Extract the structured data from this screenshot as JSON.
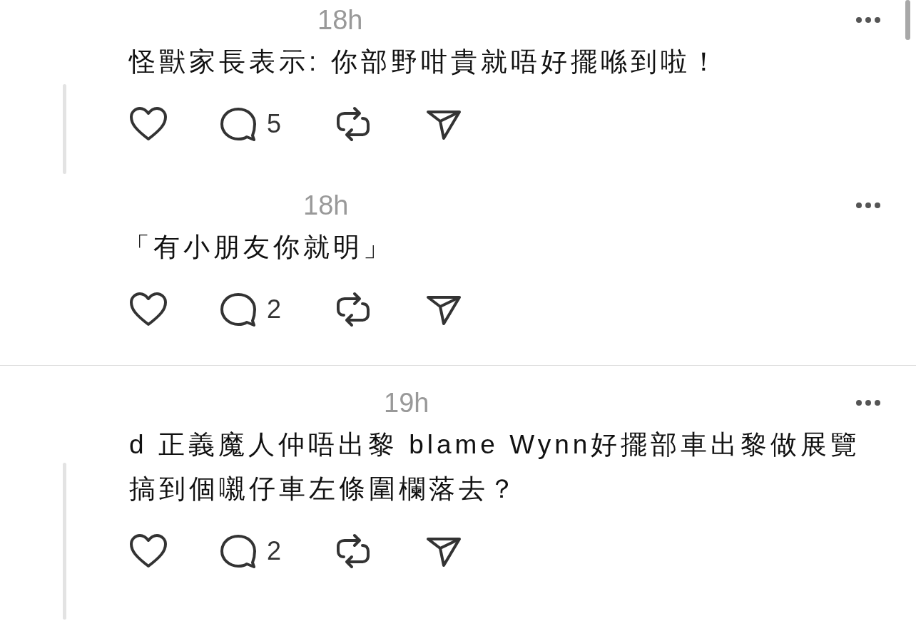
{
  "posts": [
    {
      "time": "18h",
      "text": "怪獸家長表示: 你部野咁貴就唔好擺喺到啦！",
      "comment_count": "5",
      "thread_line": true
    },
    {
      "time": "18h",
      "text": "「有小朋友你就明」",
      "comment_count": "2",
      "thread_line": false
    },
    {
      "time": "19h",
      "text": "d 正義魔人仲唔出黎 blame Wynn好擺部車出黎做展覽搞到個嚫仔車左條圍欄落去？",
      "comment_count": "2",
      "thread_line": true
    }
  ]
}
